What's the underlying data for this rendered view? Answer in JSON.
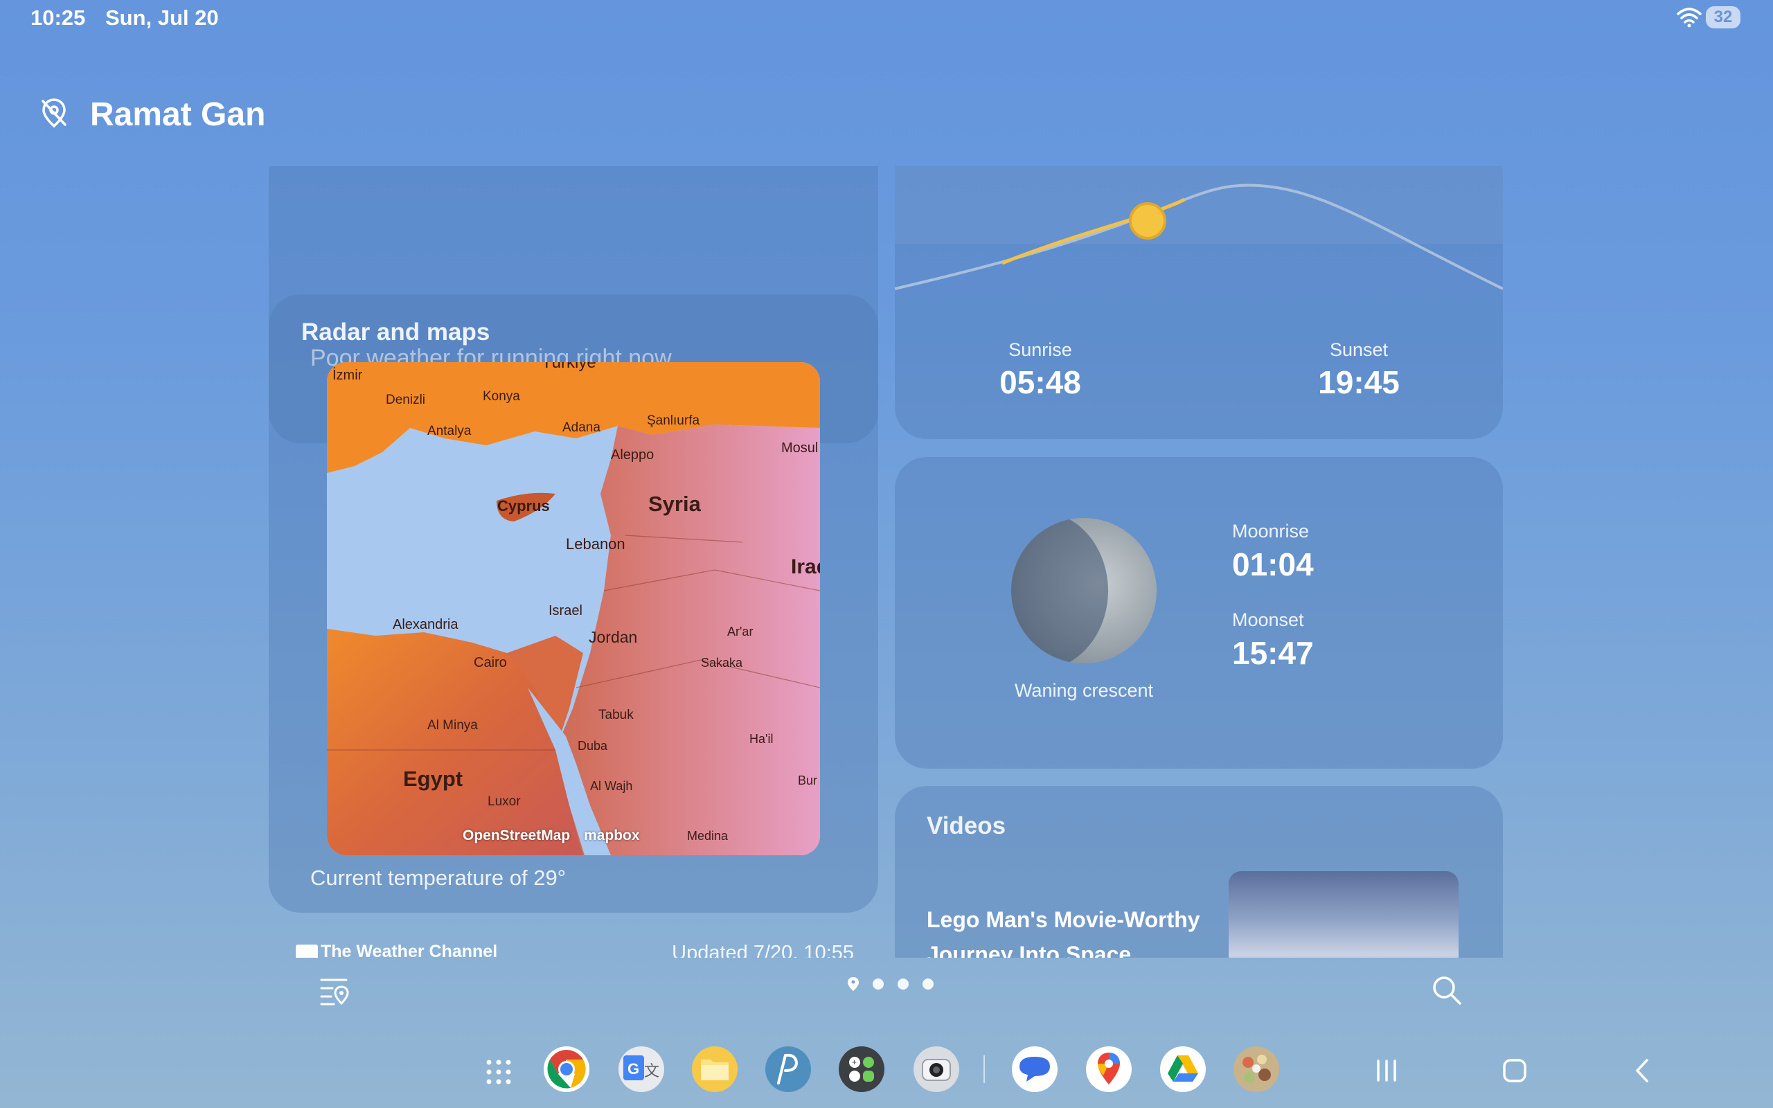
{
  "status_bar": {
    "time": "10:25",
    "date": "Sun, Jul 20",
    "battery": "32",
    "icons": [
      "wifi-icon"
    ]
  },
  "header": {
    "location_icon": "location-off-icon",
    "city": "Ramat Gan"
  },
  "activity_card": {
    "text": "Poor weather for running right now",
    "page_count": 4,
    "active_page": 1
  },
  "radar_card": {
    "title": "Radar and maps",
    "map_labels": [
      "İzmir",
      "Denizli",
      "Konya",
      "Türkiye",
      "Antalya",
      "Adana",
      "Şanlıurfa",
      "Aleppo",
      "Mosul",
      "Cyprus",
      "Syria",
      "Lebanon",
      "Iraq",
      "Alexandria",
      "Israel",
      "Jordan",
      "Ar'ar",
      "Cairo",
      "Sakaka",
      "Al Minya",
      "Tabuk",
      "Ha'il",
      "Duba",
      "Egypt",
      "Al Wajh",
      "Luxor",
      "Bur",
      "Medina"
    ],
    "attribution_osm": "OpenStreetMap",
    "attribution_mapbox": "mapbox",
    "caption": "Current temperature of 29°"
  },
  "provider": {
    "name": "The Weather Channel",
    "updated": "Updated 7/20, 10:55"
  },
  "sun_card": {
    "sunrise_label": "Sunrise",
    "sunrise": "05:48",
    "sunset_label": "Sunset",
    "sunset": "19:45",
    "colors": {
      "sun": "#f5c542",
      "daylight_path": "#f2c14a",
      "night_path": "#a9bfdc"
    }
  },
  "moon_card": {
    "phase": "Waning crescent",
    "moonrise_label": "Moonrise",
    "moonrise": "01:04",
    "moonset_label": "Moonset",
    "moonset": "15:47"
  },
  "videos_card": {
    "title": "Videos",
    "video_title": "Lego Man's Movie-Worthy Journey Into Space"
  },
  "bottom_bar": {
    "icons": [
      "list-location-icon",
      "search-icon"
    ],
    "location_page_count": 4
  },
  "dock": {
    "apps": [
      "apps-grid-icon",
      "chrome-icon",
      "google-translate-icon",
      "files-icon",
      "pen-notes-icon",
      "calculator-icon",
      "camera-icon",
      "messages-icon",
      "maps-icon",
      "drive-icon",
      "gallery-icon"
    ],
    "nav": [
      "recents-icon",
      "home-icon",
      "back-icon"
    ]
  }
}
